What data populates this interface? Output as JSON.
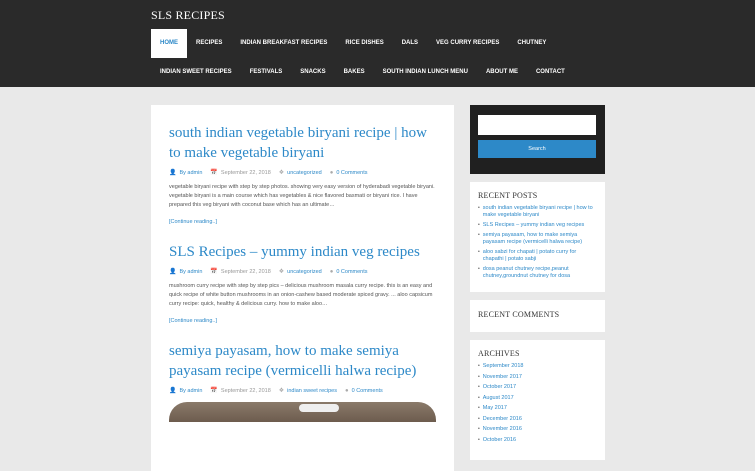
{
  "site": {
    "title": "SLS RECIPES"
  },
  "nav": {
    "row1": [
      "HOME",
      "RECIPES",
      "INDIAN BREAKFAST RECIPES",
      "RICE DISHES",
      "DALS",
      "VEG CURRY RECIPES",
      "CHUTNEY"
    ],
    "row2": [
      "INDIAN SWEET RECIPES",
      "FESTIVALS",
      "SNACKS",
      "BAKES",
      "SOUTH INDIAN LUNCH MENU",
      "ABOUT ME",
      "CONTACT"
    ]
  },
  "posts": [
    {
      "title": "south indian vegetable biryani recipe | how to make vegetable biryani",
      "author": "By admin",
      "date": "September 22, 2018",
      "category": "uncategorized",
      "comments": "0 Comments",
      "excerpt": "vegetable biryani recipe with step by step photos. showing very easy version of hyderabadi vegetable biryani. vegetable biryani is a main course which has vegetables & nice flavored basmati or biryani rice. I have prepared this veg biryani with coconut base which has an ultimate…",
      "more": "[Continue reading..]"
    },
    {
      "title": "SLS Recipes – yummy indian veg recipes",
      "author": "By admin",
      "date": "September 22, 2018",
      "category": "uncategorized",
      "comments": "0 Comments",
      "excerpt": "mushroom curry recipe with step by step pics – delicious mushroom masala curry recipe. this is an easy and quick recipe of white button mushrooms in an onion-cashew based moderate spiced gravy. ... aloo capsicum curry recipe: quick, healthy & delicious curry. how to make aloo…",
      "more": "[Continue reading..]"
    },
    {
      "title": "semiya payasam, how to make semiya payasam recipe (vermicelli halwa recipe)",
      "author": "By admin",
      "date": "September 22, 2018",
      "category": "indian sweet recipes",
      "comments": "0 Comments"
    }
  ],
  "sidebar": {
    "search_button": "Search",
    "search_placeholder": "",
    "recent_posts_title": "RECENT POSTS",
    "recent_posts": [
      "south indian vegetable biryani recipe | how to make vegetable biryani",
      "SLS Recipes – yummy indian veg recipes",
      "semiya payasam, how to make semiya payasam recipe (vermicelli halwa recipe)",
      "aloo sabzi for chapati | potato curry for chapathi | potato sabji",
      "dosa peanut chutney recipe,peanut chutney,groundnut chutney for dosa"
    ],
    "recent_comments_title": "RECENT COMMENTS",
    "archives_title": "ARCHIVES",
    "archives": [
      "September 2018",
      "November 2017",
      "October 2017",
      "August 2017",
      "May 2017",
      "December 2016",
      "November 2016",
      "October 2016"
    ]
  },
  "icons": {
    "author": "user-icon",
    "date": "calendar-icon",
    "category": "tag-icon",
    "comments": "comment-icon"
  },
  "colors": {
    "accent": "#2d89c8",
    "header_bg": "#2a2a2a",
    "page_bg": "#e9e9e9"
  }
}
